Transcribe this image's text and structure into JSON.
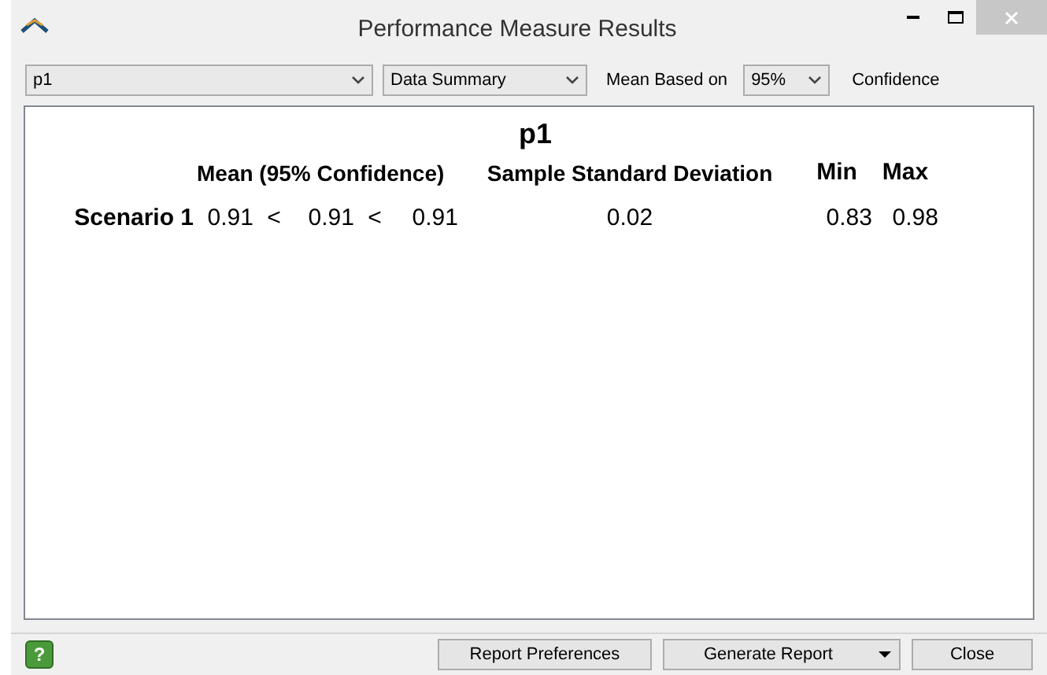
{
  "window": {
    "title": "Performance Measure Results"
  },
  "toolbar": {
    "measure": {
      "value": "p1"
    },
    "view": {
      "value": "Data Summary"
    },
    "mean_label": "Mean Based on",
    "confidence": {
      "value": "95%"
    },
    "confidence_label": "Confidence"
  },
  "report": {
    "title": "p1",
    "columns": [
      "Mean (95% Confidence)",
      "Sample Standard Deviation",
      "Min",
      "Max"
    ],
    "rows": [
      {
        "label": "Scenario 1",
        "lower": "0.91",
        "sep_1": "<",
        "mean": "0.91",
        "sep_2": "<",
        "upper": "0.91",
        "std_dev": "0.02",
        "min": "0.83",
        "max": "0.98"
      }
    ]
  },
  "buttons": {
    "help": "?",
    "preferences": "Report Preferences",
    "generate": "Generate Report",
    "close": "Close"
  }
}
